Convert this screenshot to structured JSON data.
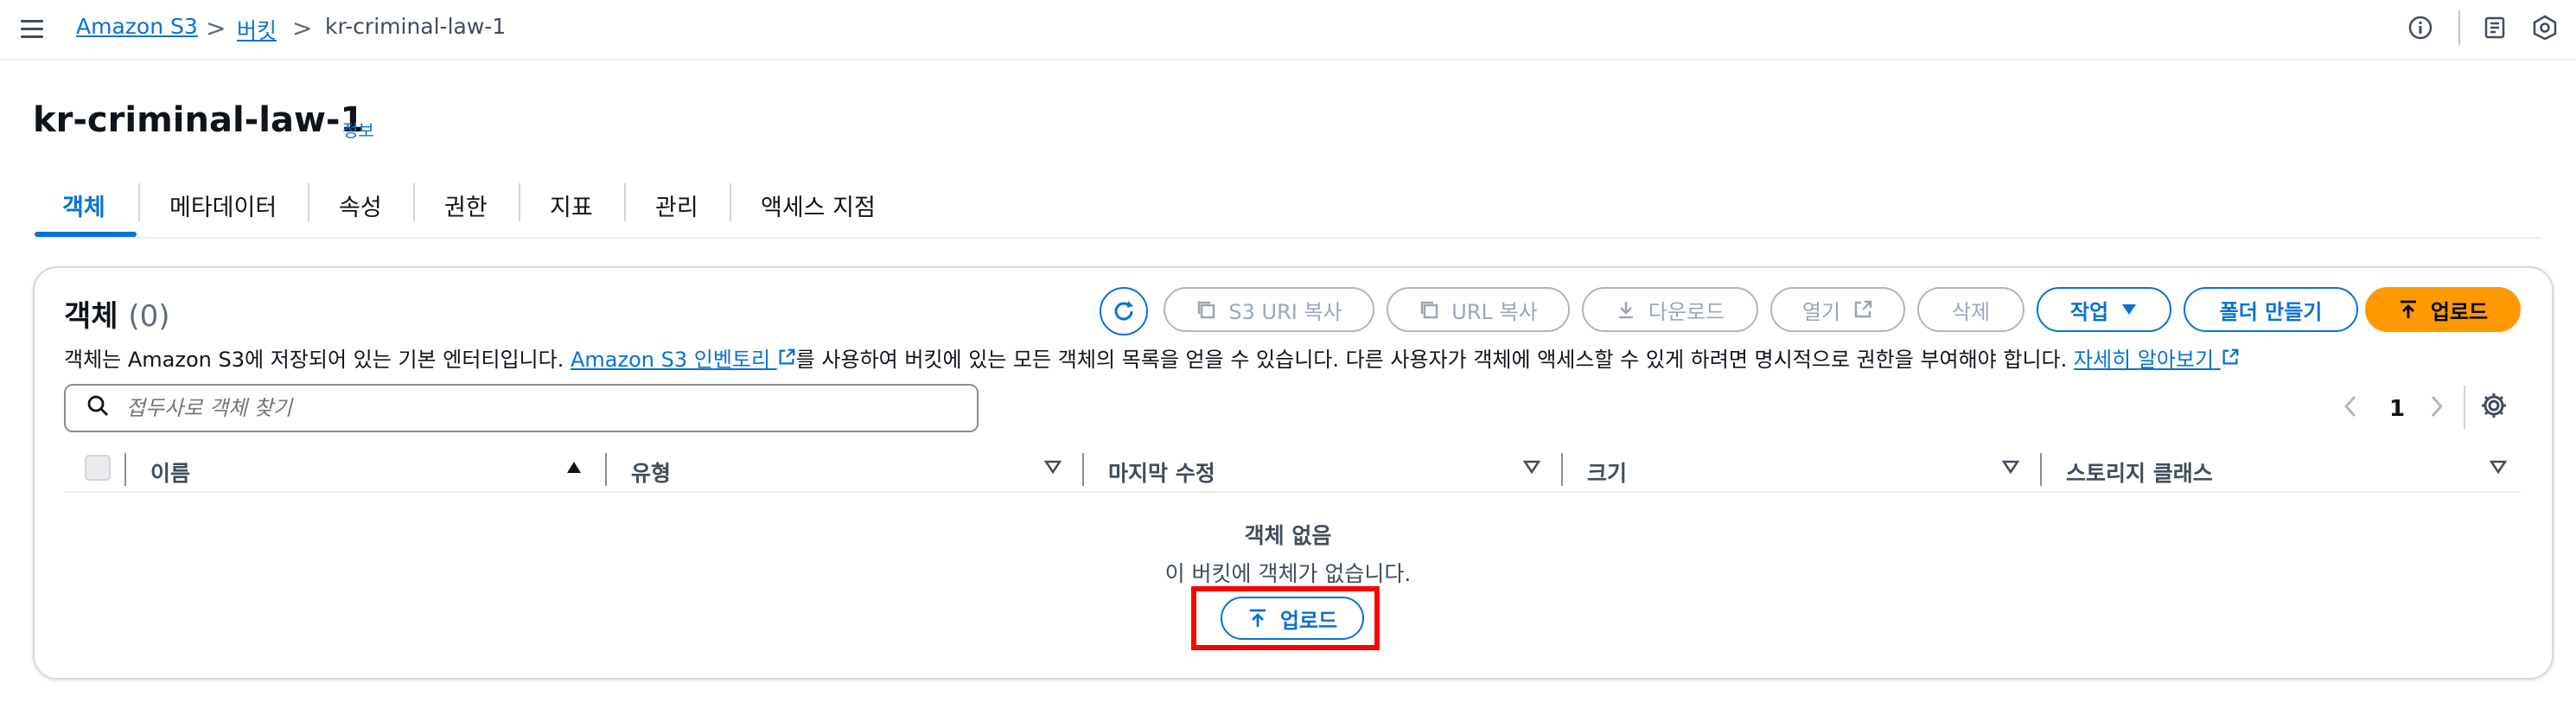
{
  "breadcrumb": {
    "items": [
      "Amazon S3",
      "버킷",
      "kr-criminal-law-1"
    ],
    "separator": ">"
  },
  "page": {
    "title": "kr-criminal-law-1",
    "info_link": "정보"
  },
  "tabs": [
    "객체",
    "메타데이터",
    "속성",
    "권한",
    "지표",
    "관리",
    "액세스 지점"
  ],
  "active_tab": "객체",
  "objects_panel": {
    "heading": "객체",
    "count": "(0)",
    "description_parts": {
      "before": "객체는 Amazon S3에 저장되어 있는 기본 엔터티입니다. ",
      "inventory_link": "Amazon S3 인벤토리",
      "middle": "를 사용하여 버킷에 있는 모든 객체의 목록을 얻을 수 있습니다. 다른 사용자가 객체에 액세스할 수 있게 하려면 명시적으로 권한을 부여해야 합니다. ",
      "learn_more_link": "자세히 알아보기"
    },
    "buttons": {
      "copy_s3_uri": "S3 URI 복사",
      "copy_url": "URL 복사",
      "download": "다운로드",
      "open": "열기",
      "delete": "삭제",
      "actions": "작업",
      "create_folder": "폴더 만들기",
      "upload": "업로드"
    },
    "search_placeholder": "접두사로 객체 찾기",
    "pagination": {
      "current_page": "1"
    },
    "columns": [
      "이름",
      "유형",
      "마지막 수정",
      "크기",
      "스토리지 클래스"
    ],
    "empty_state": {
      "title": "객체 없음",
      "description": "이 버킷에 객체가 없습니다.",
      "upload_button": "업로드"
    }
  },
  "colors": {
    "link": "#0972d3",
    "primary_button": "#ff9900",
    "highlight_box": "#ff0000"
  },
  "icons": [
    "menu-icon",
    "info-circle-icon",
    "notifications-icon",
    "settings-hex-icon",
    "refresh-icon",
    "copy-icon",
    "download-icon",
    "external-link-icon",
    "caret-down-icon",
    "upload-icon",
    "search-icon",
    "angle-left-icon",
    "angle-right-icon",
    "gear-icon",
    "sort-ascending-icon",
    "sort-descending-icon"
  ]
}
